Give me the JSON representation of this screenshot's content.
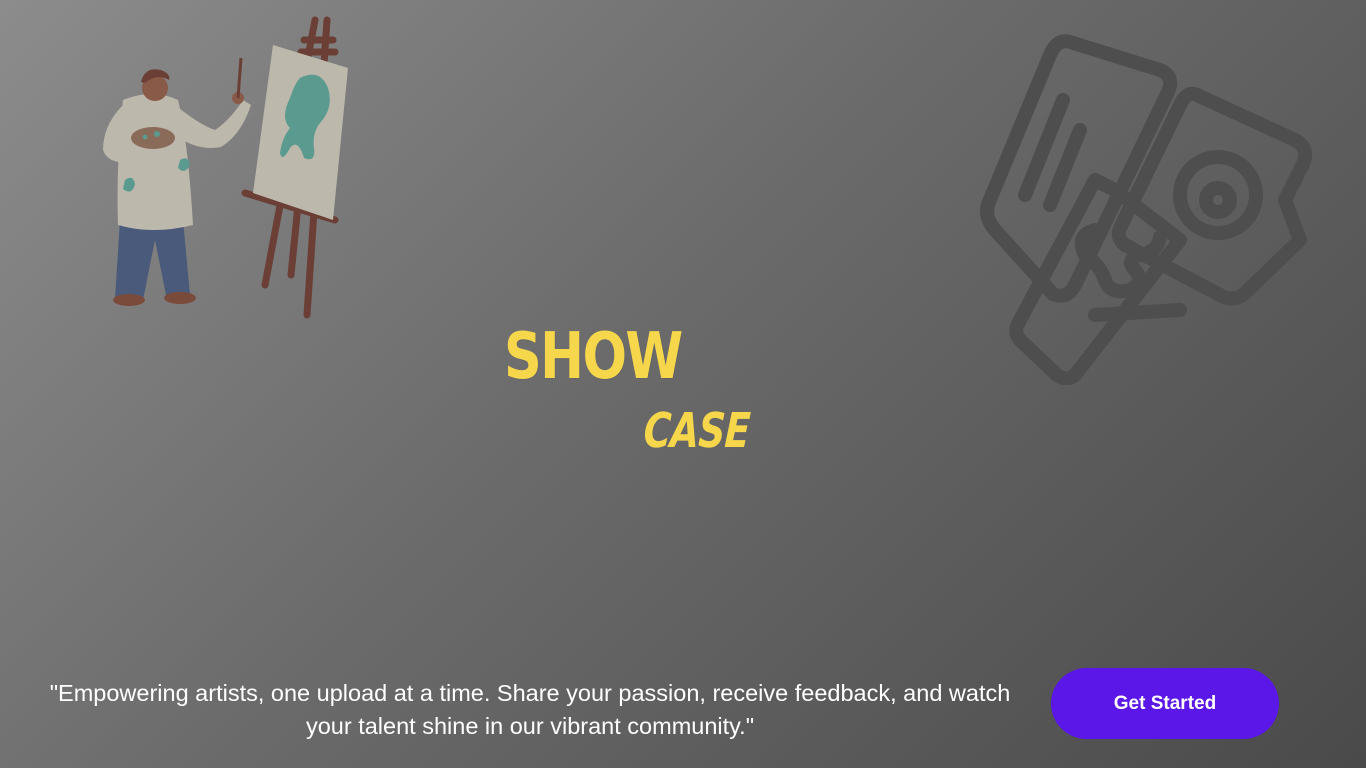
{
  "brand": {
    "line1": "SHOW",
    "line2": "CASE",
    "color": "#f6d64a"
  },
  "hero": {
    "tagline": "\"Empowering artists, one upload at a time. Share your passion, receive feedback, and watch your talent shine in our vibrant community.\"",
    "cta_label": "Get Started",
    "cta_color": "#5b16e8"
  },
  "illustrations": {
    "left": "painter-at-easel-illustration",
    "right": "gallery-photo-cards-icon"
  }
}
